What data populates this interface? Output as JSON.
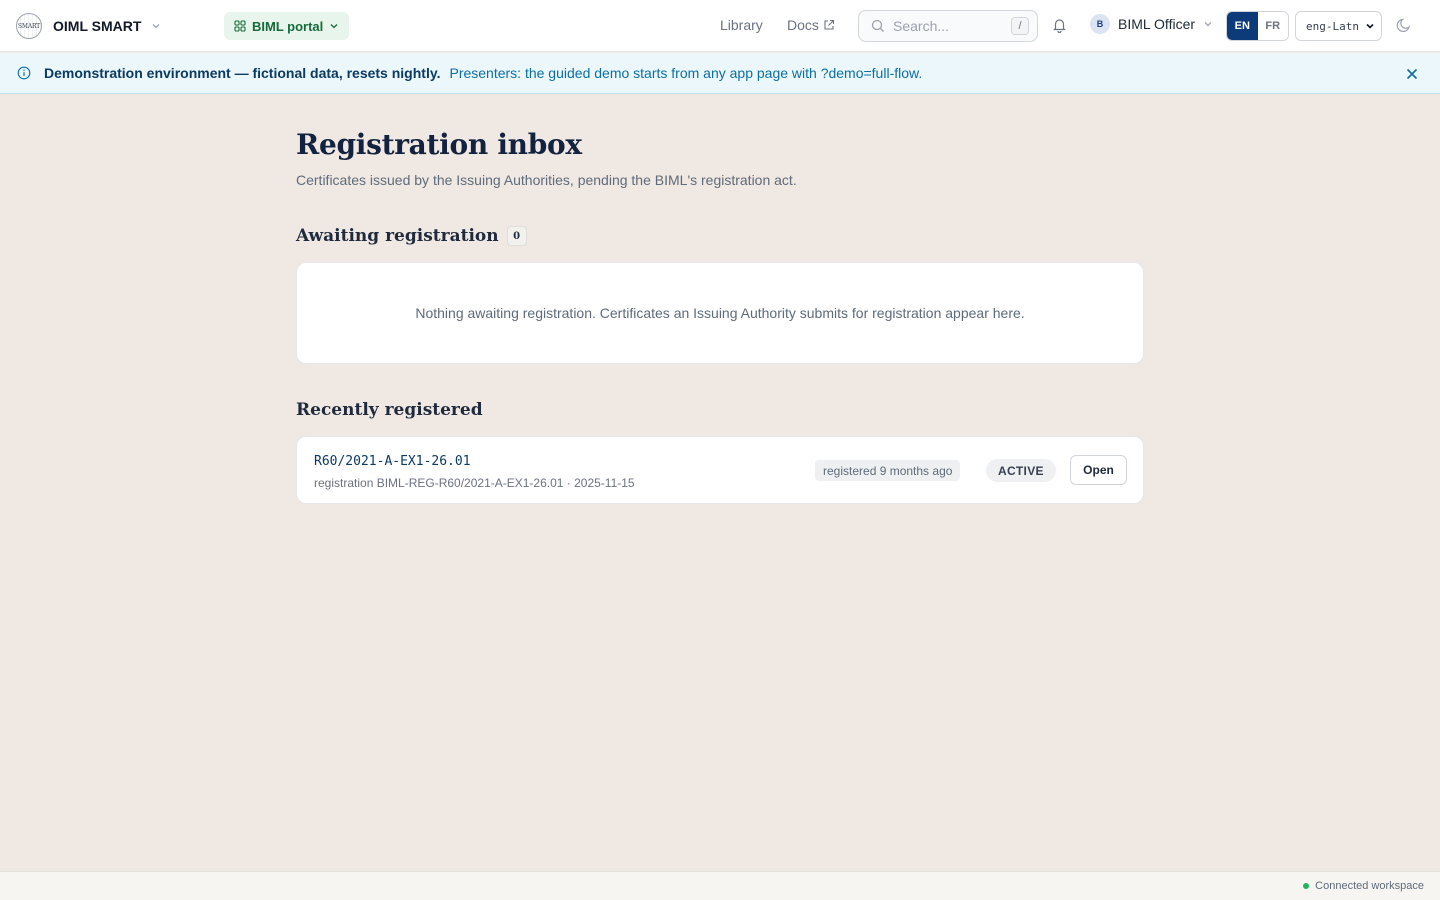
{
  "header": {
    "brand_logo_text": "SMART",
    "brand_name": "OIML SMART",
    "portal_label": "BIML portal",
    "nav": {
      "library": "Library",
      "docs": "Docs"
    },
    "search": {
      "placeholder": "Search...",
      "shortcut": "/"
    },
    "user": {
      "initial": "B",
      "name": "BIML Officer"
    },
    "languages": [
      "EN",
      "FR"
    ],
    "active_language": "EN",
    "script_select_value": "eng-Latn"
  },
  "banner": {
    "strong": "Demonstration environment — fictional data, resets nightly.",
    "text": "Presenters: the guided demo starts from any app page with ?demo=full-flow."
  },
  "main": {
    "title": "Registration inbox",
    "subtitle": "Certificates issued by the Issuing Authorities, pending the BIML's registration act.",
    "awaiting": {
      "title": "Awaiting registration",
      "count": "0",
      "empty_text": "Nothing awaiting registration. Certificates an Issuing Authority submits for registration appear here."
    },
    "recent": {
      "title": "Recently registered",
      "items": [
        {
          "id": "R60/2021-A-EX1-26.01",
          "meta": "registration BIML-REG-R60/2021-A-EX1-26.01 · 2025-11-15",
          "ago": "registered 9 months ago",
          "status": "ACTIVE",
          "action": "Open"
        }
      ]
    }
  },
  "footer": {
    "status": "Connected workspace"
  },
  "colors": {
    "page_bg": "#f0e8e2",
    "brand_navy": "#0d3b7a",
    "portal_green": "#176b3a",
    "banner_bg": "#ebf7fb",
    "status_green": "#22b35e"
  },
  "icons": [
    "globe-logo",
    "chevron-down-icon",
    "grid-icon",
    "external-link-icon",
    "search-icon",
    "bell-icon",
    "info-icon",
    "close-icon",
    "moon-icon"
  ]
}
